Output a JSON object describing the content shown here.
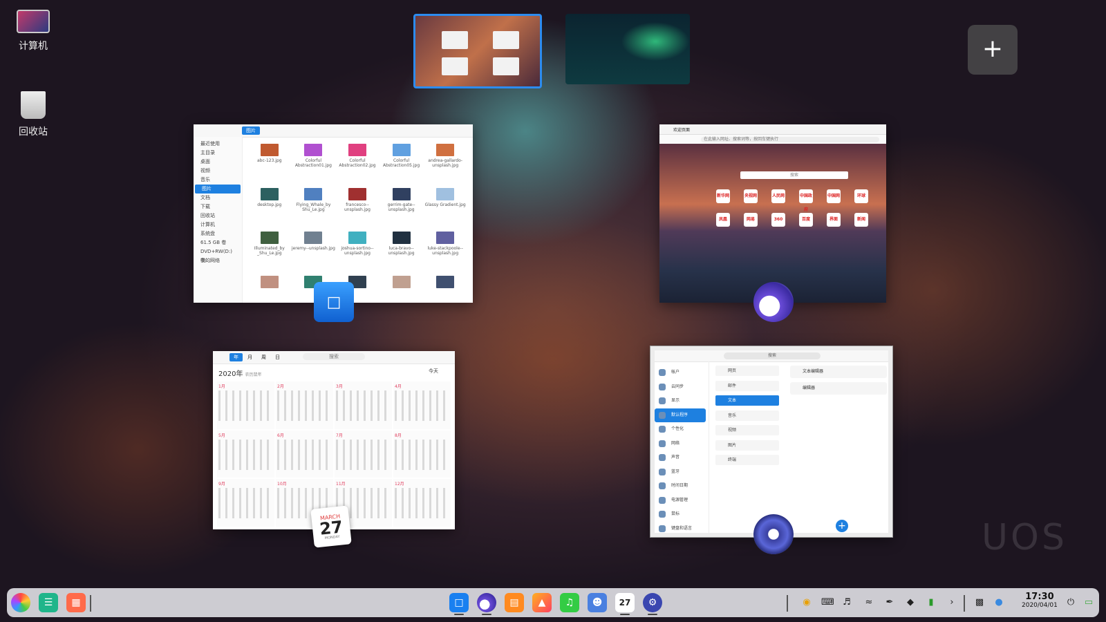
{
  "desktop": {
    "icons": [
      {
        "label": "计算机",
        "icon": "computer-icon"
      },
      {
        "label": "回收站",
        "icon": "trash-icon"
      }
    ]
  },
  "workspace": {
    "add_label": "+",
    "active_border_color": "#2c8cf0"
  },
  "windows": {
    "file_manager": {
      "tab_label": "图片",
      "sidebar": [
        "最近使用",
        "主目录",
        "桌面",
        "视频",
        "音乐",
        "图片",
        "文档",
        "下载",
        "回收站",
        "计算机",
        "系统盘",
        "61.5 GB 卷",
        "DVD+RW(D:)中…",
        "我的网络"
      ],
      "active_index": 5,
      "files": [
        "abc-123.jpg",
        "Colorful Abstraction01.jpg",
        "Colorful Abstraction02.jpg",
        "Colorful Abstraction05.jpg",
        "andrea-gallardo-unsplash.jpg",
        "desktop.jpg",
        "Flying_Whale_by Shu_Le.jpg",
        "francesco--unsplash.jpg",
        "gerrim-gate--unsplash.jpg",
        "Glassy Gradient.jpg",
        "Illuminated_by _Shu_Le.jpg",
        "jeremy--unsplash.jpg",
        "joshua-sortino--unsplash.jpg",
        "luca-bravo--unsplash.jpg",
        "luke-stackpoole--unsplash.jpg",
        "",
        "",
        "",
        "",
        ""
      ],
      "thumb_colors": [
        "#c05a30",
        "#b050d0",
        "#e04080",
        "#60a0e0",
        "#d07040",
        "#2c6060",
        "#5080c0",
        "#a03030",
        "#304060",
        "#a0c0e0",
        "#406040",
        "#708090",
        "#40b0c0",
        "#203040",
        "#6060a0",
        "#c09080",
        "#308070",
        "#304050",
        "#c0a090",
        "#405070"
      ]
    },
    "browser": {
      "tab_label": "欢迎页面",
      "address_placeholder": "在此输入网址、搜索词等，按回车键执行",
      "search_placeholder": "搜索",
      "tiles": [
        "新华网",
        "央视网",
        "人民网",
        "中国政府",
        "中国网",
        "环球",
        "凤凰",
        "网易",
        "360",
        "百度",
        "界面",
        "新闻"
      ]
    },
    "calendar": {
      "year_label": "2020年",
      "year_sub": "农历鼠年",
      "view_tabs": [
        "年",
        "月",
        "周",
        "日"
      ],
      "search_placeholder": "搜索",
      "today_label": "今天",
      "months": [
        "1月",
        "2月",
        "3月",
        "4月",
        "5月",
        "6月",
        "7月",
        "8月",
        "9月",
        "10月",
        "11月",
        "12月"
      ]
    },
    "settings": {
      "search_placeholder": "搜索",
      "nav": [
        "帐户",
        "云同步",
        "显示",
        "默认程序",
        "个性化",
        "网络",
        "声音",
        "蓝牙",
        "时间日期",
        "电源管理",
        "鼠标",
        "键盘和语言"
      ],
      "active_nav": 3,
      "categories": [
        "网页",
        "邮件",
        "文本",
        "音乐",
        "视频",
        "图片",
        "终端"
      ],
      "active_category": 2,
      "apps": [
        "文本编辑器",
        "编辑器"
      ],
      "add_label": "+"
    }
  },
  "app_badges": {
    "file_manager": "file-manager-icon",
    "browser": "browser-icon",
    "calendar_month": "MARCH",
    "calendar_day": "27",
    "calendar_weekday": "MONDAY",
    "settings": "settings-icon"
  },
  "watermark": "UOS",
  "dock": {
    "left_apps": [
      "launcher-icon",
      "multitask-view-icon",
      "desktop-icon"
    ],
    "center_apps": [
      "file-manager-icon",
      "browser-icon",
      "app-store-icon",
      "image-viewer-icon",
      "music-icon",
      "contacts-icon",
      "calendar-icon",
      "settings-icon"
    ],
    "tray": [
      "input-method-icon",
      "keyboard-icon",
      "volume-icon",
      "wifi-icon",
      "pen-icon",
      "notification-icon",
      "battery-icon",
      "expand-icon"
    ],
    "clock_time": "17:30",
    "clock_date": "2020/04/01"
  }
}
